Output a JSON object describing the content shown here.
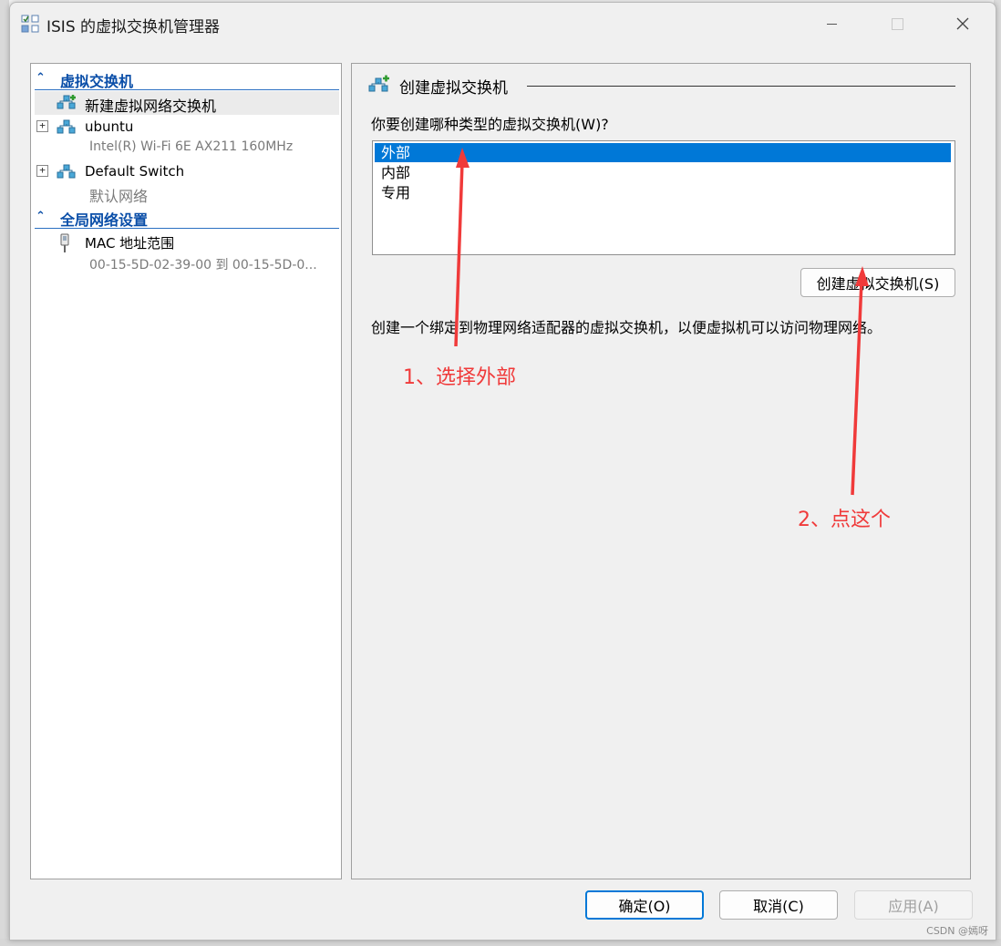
{
  "window": {
    "title": "ISIS 的虚拟交换机管理器"
  },
  "tree": {
    "sections": [
      {
        "label": "虚拟交换机"
      },
      {
        "label": "全局网络设置"
      }
    ],
    "items": [
      {
        "label": "新建虚拟网络交换机",
        "sub": ""
      },
      {
        "label": "ubuntu",
        "sub": "Intel(R) Wi-Fi 6E AX211 160MHz",
        "expand": "+"
      },
      {
        "label": "Default Switch",
        "sub": "默认网络",
        "expand": "+"
      },
      {
        "label": "MAC 地址范围",
        "sub": "00-15-5D-02-39-00 到 00-15-5D-0..."
      }
    ]
  },
  "panel": {
    "title": "创建虚拟交换机",
    "question": "你要创建哪种类型的虚拟交换机(W)?",
    "options": [
      "外部",
      "内部",
      "专用"
    ],
    "selected_option": "外部",
    "create_button": "创建虚拟交换机(S)",
    "description": "创建一个绑定到物理网络适配器的虚拟交换机，以便虚拟机可以访问物理网络。"
  },
  "footer": {
    "ok": "确定(O)",
    "cancel": "取消(C)",
    "apply": "应用(A)"
  },
  "annotations": {
    "step1": "1、选择外部",
    "step2": "2、点这个"
  },
  "watermark": "CSDN @嫣呀",
  "colors": {
    "selection": "#0078d7",
    "section_header": "#0a4ea8",
    "annotation": "#f03a3a"
  }
}
